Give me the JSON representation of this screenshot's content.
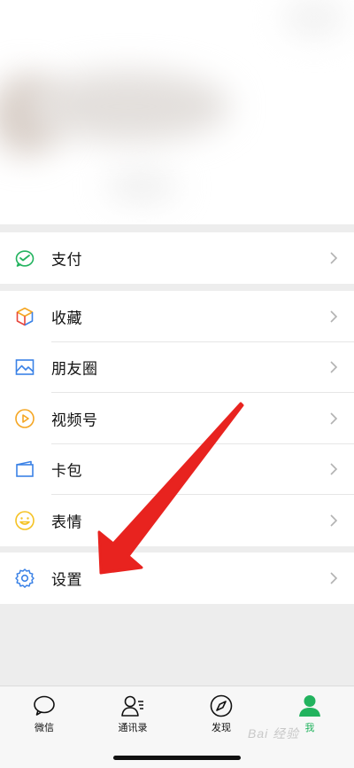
{
  "menu_groups": [
    {
      "items": [
        {
          "label": "支付",
          "icon": "pay-icon"
        }
      ]
    },
    {
      "items": [
        {
          "label": "收藏",
          "icon": "favorites-icon"
        },
        {
          "label": "朋友圈",
          "icon": "moments-icon"
        },
        {
          "label": "视频号",
          "icon": "channels-icon"
        },
        {
          "label": "卡包",
          "icon": "card-wallet-icon"
        },
        {
          "label": "表情",
          "icon": "stickers-icon"
        }
      ]
    },
    {
      "items": [
        {
          "label": "设置",
          "icon": "settings-icon"
        }
      ]
    }
  ],
  "tabbar": {
    "tabs": [
      {
        "label": "微信",
        "icon": "chat-icon",
        "active": false
      },
      {
        "label": "通讯录",
        "icon": "contacts-icon",
        "active": false
      },
      {
        "label": "发现",
        "icon": "discover-compass-icon",
        "active": false
      },
      {
        "label": "我",
        "icon": "me-person-icon",
        "active": true
      }
    ]
  },
  "watermark": "Bai 经验",
  "colors": {
    "accent_green": "#22b35e",
    "arrow_red": "#e8231f",
    "background": "#ededed"
  }
}
